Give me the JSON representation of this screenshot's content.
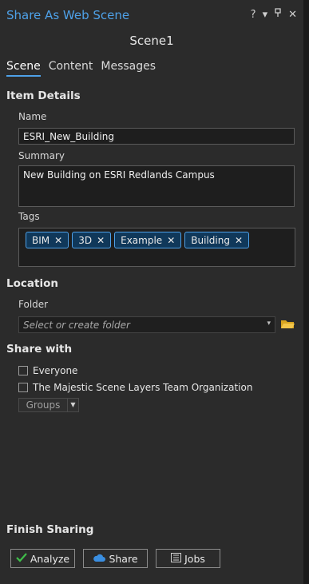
{
  "window": {
    "title": "Share As Web Scene",
    "help": "?",
    "menu": "▾",
    "pin": "⊓",
    "close": "✕"
  },
  "subtitle": "Scene1",
  "tabs": [
    {
      "label": "Scene"
    },
    {
      "label": "Content"
    },
    {
      "label": "Messages"
    }
  ],
  "item_details": {
    "heading": "Item Details",
    "name_label": "Name",
    "name_value": "ESRI_New_Building",
    "summary_label": "Summary",
    "summary_value": "New Building on ESRI Redlands Campus",
    "tags_label": "Tags",
    "tags": [
      "BIM",
      "3D",
      "Example",
      "Building"
    ]
  },
  "location": {
    "heading": "Location",
    "folder_label": "Folder",
    "folder_placeholder": "Select or create folder"
  },
  "share_with": {
    "heading": "Share with",
    "everyone": "Everyone",
    "organization": "The Majestic Scene Layers Team Organization",
    "groups": "Groups"
  },
  "finish": {
    "heading": "Finish Sharing",
    "analyze": "Analyze",
    "share": "Share",
    "jobs": "Jobs"
  },
  "colors": {
    "accent": "#4ea1e8",
    "background": "#2b2b2b"
  }
}
